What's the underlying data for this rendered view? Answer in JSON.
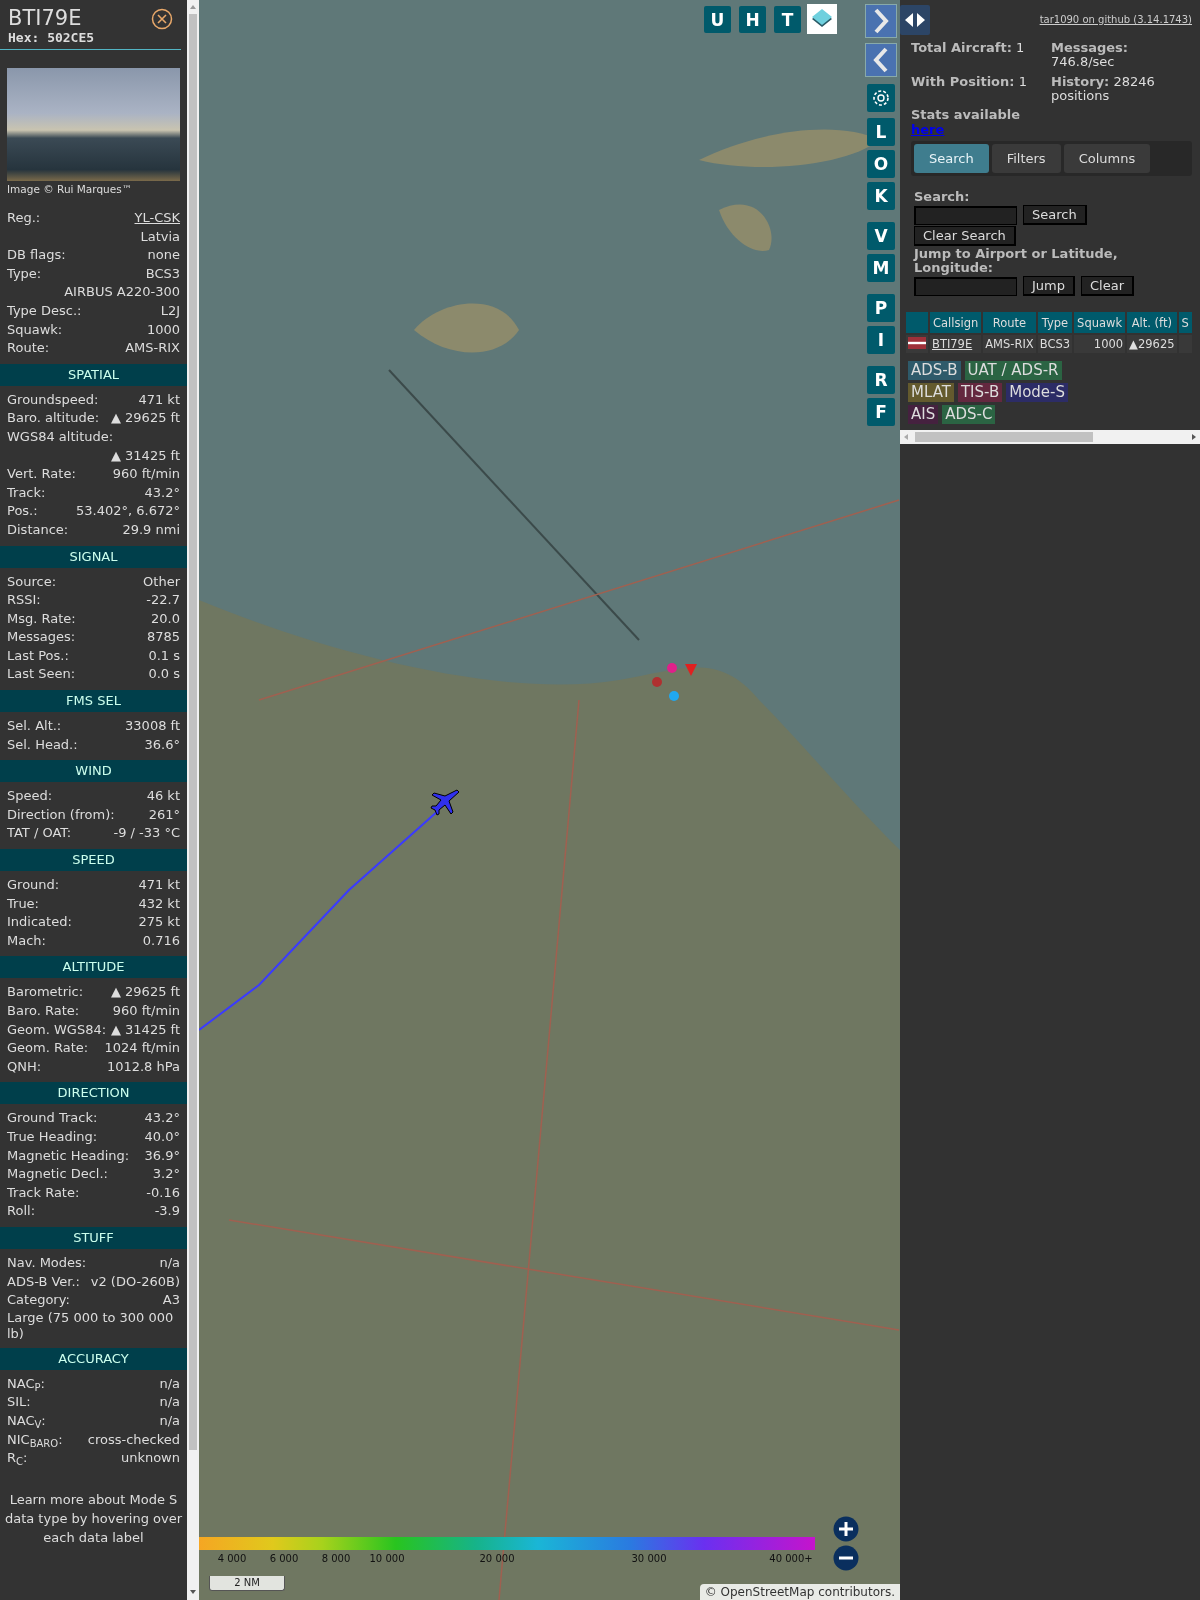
{
  "aircraft": {
    "callsign": "BTI79E",
    "hex": "Hex: 502CE5",
    "photo_credit": "Image © Rui Marques™",
    "details": [
      {
        "kind": "link",
        "label": "Reg.:",
        "value": "YL-CSK"
      },
      {
        "kind": "value",
        "value": "Latvia"
      },
      {
        "kind": "pair",
        "label": "DB flags:",
        "value": "none"
      },
      {
        "kind": "pair",
        "label": "Type:",
        "value": "BCS3"
      },
      {
        "kind": "value",
        "value": "AIRBUS A220-300"
      },
      {
        "kind": "pair",
        "label": "Type Desc.:",
        "value": "L2J"
      },
      {
        "kind": "pair",
        "label": "Squawk:",
        "value": "1000"
      },
      {
        "kind": "pair",
        "label": "Route:",
        "value": "AMS-RIX"
      }
    ],
    "sections": [
      {
        "title": "SPATIAL",
        "rows": [
          {
            "kind": "pair",
            "label": "Groundspeed:",
            "value": "471 kt"
          },
          {
            "kind": "pair",
            "label": "Baro. altitude:",
            "value": "▲ 29625 ft"
          },
          {
            "kind": "label",
            "label": "WGS84 altitude:"
          },
          {
            "kind": "value",
            "value": "▲ 31425 ft"
          },
          {
            "kind": "pair",
            "label": "Vert. Rate:",
            "value": "960 ft/min"
          },
          {
            "kind": "pair",
            "label": "Track:",
            "value": "43.2°"
          },
          {
            "kind": "pair",
            "label": "Pos.:",
            "value": "53.402°, 6.672°"
          },
          {
            "kind": "pair",
            "label": "Distance:",
            "value": "29.9 nmi"
          }
        ]
      },
      {
        "title": "SIGNAL",
        "rows": [
          {
            "kind": "pair",
            "label": "Source:",
            "value": "Other"
          },
          {
            "kind": "pair",
            "label": "RSSI:",
            "value": "-22.7"
          },
          {
            "kind": "pair",
            "label": "Msg. Rate:",
            "value": "20.0"
          },
          {
            "kind": "pair",
            "label": "Messages:",
            "value": "8785"
          },
          {
            "kind": "pair",
            "label": "Last Pos.:",
            "value": "0.1 s"
          },
          {
            "kind": "pair",
            "label": "Last Seen:",
            "value": "0.0 s"
          }
        ]
      },
      {
        "title": "FMS SEL",
        "rows": [
          {
            "kind": "pair",
            "label": "Sel. Alt.:",
            "value": "33008 ft"
          },
          {
            "kind": "pair",
            "label": "Sel. Head.:",
            "value": "36.6°"
          }
        ]
      },
      {
        "title": "WIND",
        "rows": [
          {
            "kind": "pair",
            "label": "Speed:",
            "value": "46 kt"
          },
          {
            "kind": "pair",
            "label": "Direction (from):",
            "value": "261°"
          },
          {
            "kind": "pair",
            "label": "TAT / OAT:",
            "value": "-9 / -33 °C"
          }
        ]
      },
      {
        "title": "SPEED",
        "rows": [
          {
            "kind": "pair",
            "label": "Ground:",
            "value": "471 kt"
          },
          {
            "kind": "pair",
            "label": "True:",
            "value": "432 kt"
          },
          {
            "kind": "pair",
            "label": "Indicated:",
            "value": "275 kt"
          },
          {
            "kind": "pair",
            "label": "Mach:",
            "value": "0.716"
          }
        ]
      },
      {
        "title": "ALTITUDE",
        "rows": [
          {
            "kind": "pair",
            "label": "Barometric:",
            "value": "▲ 29625 ft"
          },
          {
            "kind": "pair",
            "label": "Baro. Rate:",
            "value": "960 ft/min"
          },
          {
            "kind": "pair",
            "label": "Geom. WGS84:",
            "value": "▲ 31425 ft"
          },
          {
            "kind": "pair",
            "label": "Geom. Rate:",
            "value": "1024 ft/min"
          },
          {
            "kind": "pair",
            "label": "QNH:",
            "value": "1012.8 hPa"
          }
        ]
      },
      {
        "title": "DIRECTION",
        "rows": [
          {
            "kind": "pair",
            "label": "Ground Track:",
            "value": "43.2°"
          },
          {
            "kind": "pair",
            "label": "True Heading:",
            "value": "40.0°"
          },
          {
            "kind": "pair",
            "label": "Magnetic Heading:",
            "value": "36.9°"
          },
          {
            "kind": "pair",
            "label": "Magnetic Decl.:",
            "value": "3.2°"
          },
          {
            "kind": "pair",
            "label": "Track Rate:",
            "value": "-0.16"
          },
          {
            "kind": "pair",
            "label": "Roll:",
            "value": "-3.9"
          }
        ]
      },
      {
        "title": "STUFF",
        "rows": [
          {
            "kind": "pair",
            "label": "Nav. Modes:",
            "value": "n/a"
          },
          {
            "kind": "pair",
            "label": "ADS-B Ver.:",
            "value": "v2 (DO-260B)"
          },
          {
            "kind": "pair",
            "label": "Category:",
            "value": "A3"
          },
          {
            "kind": "note",
            "label": "Large (75 000 to 300 000 lb)"
          }
        ]
      },
      {
        "title": "ACCURACY",
        "rows": [
          {
            "kind": "pair",
            "label": "NAC$_{P}$:",
            "value": "n/a"
          },
          {
            "kind": "pair",
            "label": "SIL:",
            "value": "n/a"
          },
          {
            "kind": "pair",
            "label": "NAC$_{V}$:",
            "value": "n/a"
          },
          {
            "kind": "pair",
            "label": "NIC$_{BARO}$:",
            "value": "cross-checked"
          },
          {
            "kind": "pair",
            "label": "R$_{C}$:",
            "value": "unknown"
          }
        ]
      }
    ],
    "footer": "Learn more about Mode S data type by hovering over each data label"
  },
  "map": {
    "top_buttons": [
      "U",
      "H",
      "T"
    ],
    "side_buttons": [
      [
        "L",
        "O",
        "K"
      ],
      [
        "V",
        "M"
      ],
      [
        "P",
        "I"
      ],
      [
        "R",
        "F"
      ]
    ],
    "altitude_scale": [
      "4 000",
      "6 000",
      "8 000",
      "10 000",
      "20 000",
      "30 000",
      "40 000+"
    ],
    "scale": "2 NM",
    "attribution": "© OpenStreetMap contributors."
  },
  "side": {
    "version_link": "tar1090 on github (3.14.1743)",
    "stats": [
      {
        "label": "Total Aircraft:",
        "value": "1"
      },
      {
        "label": "Messages:",
        "value": "746.8/sec"
      },
      {
        "label": "With Position:",
        "value": "1"
      },
      {
        "label": "History:",
        "value": "28246 positions"
      }
    ],
    "stats_note": "Stats available",
    "stats_link": "here",
    "tabs": [
      {
        "label": "Search",
        "selected": true
      },
      {
        "label": "Filters",
        "selected": false
      },
      {
        "label": "Columns",
        "selected": false
      }
    ],
    "search": {
      "label": "Search:",
      "button": "Search",
      "clear_button": "Clear Search",
      "jump_label": "Jump to Airport or Latitude, Longitude:",
      "jump_button": "Jump",
      "jump_clear_button": "Clear"
    },
    "table": {
      "columns": [
        "Callsign",
        "Route",
        "Type",
        "Squawk",
        "Alt. (ft)",
        "S"
      ],
      "rows": [
        {
          "cells": [
            "BTI79E",
            "AMS-RIX",
            "BCS3",
            "1000",
            "▲29625"
          ]
        }
      ]
    },
    "legend": [
      {
        "label": "ADS-B",
        "color": "#2e5a6a"
      },
      {
        "label": "UAT / ADS-R",
        "color": "#2b6443"
      },
      {
        "label": "MLAT",
        "color": "#645a2e"
      },
      {
        "label": "TIS-B",
        "color": "#64283f"
      },
      {
        "label": "Mode-S",
        "color": "#2c2c66"
      },
      {
        "label": "AIS",
        "color": "#45213f"
      },
      {
        "label": "ADS-C",
        "color": "#2b6443"
      }
    ]
  }
}
